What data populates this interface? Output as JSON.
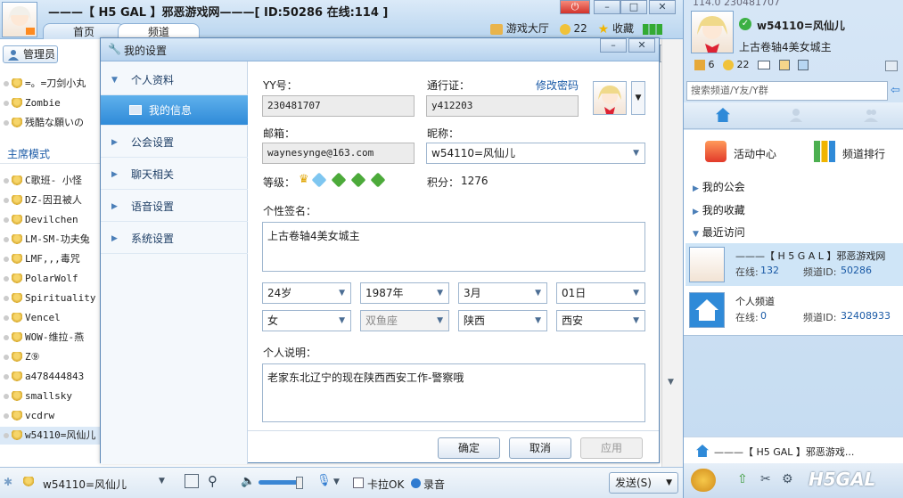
{
  "main": {
    "title": "———【 H5 GAL 】邪恶游戏网———[ ID:50286 在线:114 ]",
    "tabs": [
      "首页",
      "频道"
    ],
    "top_right": {
      "game_hall": "游戏大厅",
      "coins": "22",
      "favorite": "收藏"
    },
    "manager_label": "管理员",
    "notice_btn": "告",
    "mode_label": "主席模式",
    "top_users": [
      "=。=刀剑小丸",
      "Zombie",
      "残酷な願いの"
    ],
    "users": [
      "C歌班- 小怪",
      "DZ-因丑被人",
      "Devilchen",
      "LM-SM-功夫兔",
      "LMF,,,毒咒",
      "PolarWolf",
      "Spirituality",
      "Vencel",
      "WOW-维拉-燕",
      "Z⑨",
      "a478444843",
      "smallsky",
      "vcdrw",
      "w54110=风仙儿"
    ],
    "bottom": {
      "user": "w54110=风仙儿",
      "karaoke": "卡拉OK",
      "record": "录音",
      "send": "发送(S)"
    }
  },
  "dialog": {
    "title": "我的设置",
    "sidebar": [
      {
        "label": "个人资料"
      },
      {
        "label": "我的信息"
      },
      {
        "label": "公会设置"
      },
      {
        "label": "聊天相关"
      },
      {
        "label": "语音设置"
      },
      {
        "label": "系统设置"
      }
    ],
    "yy_label": "YY号：",
    "yy_value": "230481707",
    "pass_label": "通行证：",
    "pass_value": "y412203",
    "change_pwd": "修改密码",
    "email_label": "邮箱：",
    "email_value": "waynesynge@163.com",
    "nick_label": "昵称：",
    "nick_value": "w54110=风仙儿",
    "level_label": "等级：",
    "points_label": "积分：",
    "points_value": "1276",
    "sign_label": "个性签名：",
    "sign_value": "上古卷轴4美女城主",
    "age": "24岁",
    "year": "1987年",
    "month": "3月",
    "day": "01日",
    "gender": "女",
    "zodiac": "双鱼座",
    "province": "陕西",
    "city": "西安",
    "desc_label": "个人说明：",
    "desc_value": "老家东北辽宁的现在陕西西安工作-警察哦",
    "ok": "确定",
    "cancel": "取消",
    "apply": "应用"
  },
  "right": {
    "partial_id": "114.0 230481707",
    "name": "w54110=风仙儿",
    "sign": "上古卷轴4美女城主",
    "stat1": "6",
    "stat2": "22",
    "search_placeholder": "搜索频道/Y友/Y群",
    "activity": "活动中心",
    "ranking": "频道排行",
    "my_guild": "我的公会",
    "my_fav": "我的收藏",
    "recent": "最近访问",
    "recent1": {
      "name": "———【 H 5 G A L 】邪恶游戏网",
      "online_label": "在线:",
      "online": "132",
      "id_label": "频道ID:",
      "id": "50286"
    },
    "recent2": {
      "name": "个人频道",
      "online_label": "在线:",
      "online": "0",
      "id_label": "频道ID:",
      "id": "32408933"
    },
    "bottom_channel": "———【 H5 GAL 】邪恶游戏...",
    "logo_text": "H5GAL"
  },
  "colors": {
    "accent": "#2f8ad8",
    "link": "#1a5aa6",
    "window": "#b6d2ee"
  }
}
